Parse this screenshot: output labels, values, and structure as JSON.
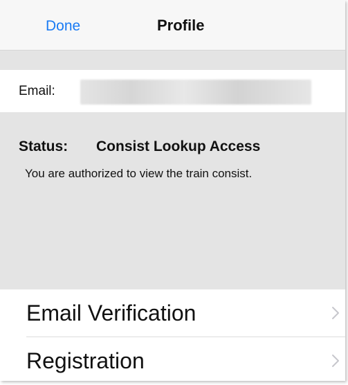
{
  "navbar": {
    "done_label": "Done",
    "title": "Profile"
  },
  "email": {
    "label": "Email:",
    "value": ""
  },
  "status": {
    "label": "Status:",
    "value": "Consist Lookup Access",
    "description": "You are authorized to view the train consist."
  },
  "menu": {
    "items": [
      {
        "label": "Email Verification",
        "icon": "chevron-right-icon"
      },
      {
        "label": "Registration",
        "icon": "chevron-right-icon"
      }
    ]
  },
  "colors": {
    "accent": "#1a7bf4",
    "grouped_background": "#e4e4e4",
    "text": "#111111",
    "chevron": "#c7c7cc"
  }
}
